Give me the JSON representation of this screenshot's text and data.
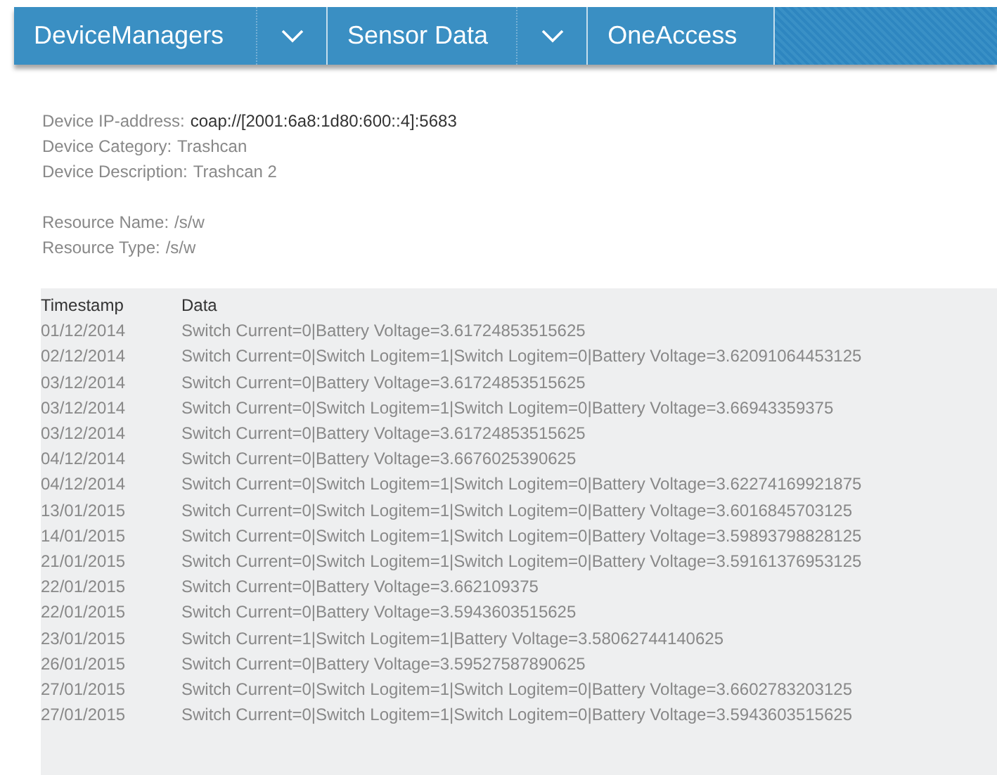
{
  "nav": [
    {
      "label": "DeviceManagers",
      "dropdown": true
    },
    {
      "label": "Sensor Data",
      "dropdown": true
    },
    {
      "label": "OneAccess",
      "dropdown": false
    }
  ],
  "device": [
    {
      "label": "Device IP-address:",
      "value": "coap://[2001:6a8:1d80:600::4]:5683",
      "emphasis": true
    },
    {
      "label": "Device Category:",
      "value": "Trashcan",
      "emphasis": false
    },
    {
      "label": "Device Description:",
      "value": "Trashcan 2",
      "emphasis": false
    }
  ],
  "resource": [
    {
      "label": "Resource Name:",
      "value": "/s/w"
    },
    {
      "label": "Resource Type:",
      "value": "/s/w"
    }
  ],
  "table": {
    "columns": [
      "Timestamp",
      "Data"
    ],
    "rows": [
      [
        "01/12/2014",
        "Switch Current=0|Battery Voltage=3.61724853515625"
      ],
      [
        "02/12/2014",
        "Switch Current=0|Switch Logitem=1|Switch Logitem=0|Battery Voltage=3.62091064453125"
      ],
      [
        "03/12/2014",
        "Switch Current=0|Battery Voltage=3.61724853515625"
      ],
      [
        "03/12/2014",
        "Switch Current=0|Switch Logitem=1|Switch Logitem=0|Battery Voltage=3.66943359375"
      ],
      [
        "03/12/2014",
        "Switch Current=0|Battery Voltage=3.61724853515625"
      ],
      [
        "04/12/2014",
        "Switch Current=0|Battery Voltage=3.6676025390625"
      ],
      [
        "04/12/2014",
        "Switch Current=0|Switch Logitem=1|Switch Logitem=0|Battery Voltage=3.62274169921875"
      ],
      [
        "13/01/2015",
        "Switch Current=0|Switch Logitem=1|Switch Logitem=0|Battery Voltage=3.6016845703125"
      ],
      [
        "14/01/2015",
        "Switch Current=0|Switch Logitem=1|Switch Logitem=0|Battery Voltage=3.59893798828125"
      ],
      [
        "21/01/2015",
        "Switch Current=0|Switch Logitem=1|Switch Logitem=0|Battery Voltage=3.59161376953125"
      ],
      [
        "22/01/2015",
        "Switch Current=0|Battery Voltage=3.662109375"
      ],
      [
        "22/01/2015",
        "Switch Current=0|Battery Voltage=3.5943603515625"
      ],
      [
        "23/01/2015",
        "Switch Current=1|Switch Logitem=1|Battery Voltage=3.58062744140625"
      ],
      [
        "26/01/2015",
        "Switch Current=0|Battery Voltage=3.59527587890625"
      ],
      [
        "27/01/2015",
        "Switch Current=0|Switch Logitem=1|Switch Logitem=0|Battery Voltage=3.6602783203125"
      ],
      [
        "27/01/2015",
        "Switch Current=0|Switch Logitem=1|Switch Logitem=0|Battery Voltage=3.5943603515625"
      ]
    ]
  }
}
